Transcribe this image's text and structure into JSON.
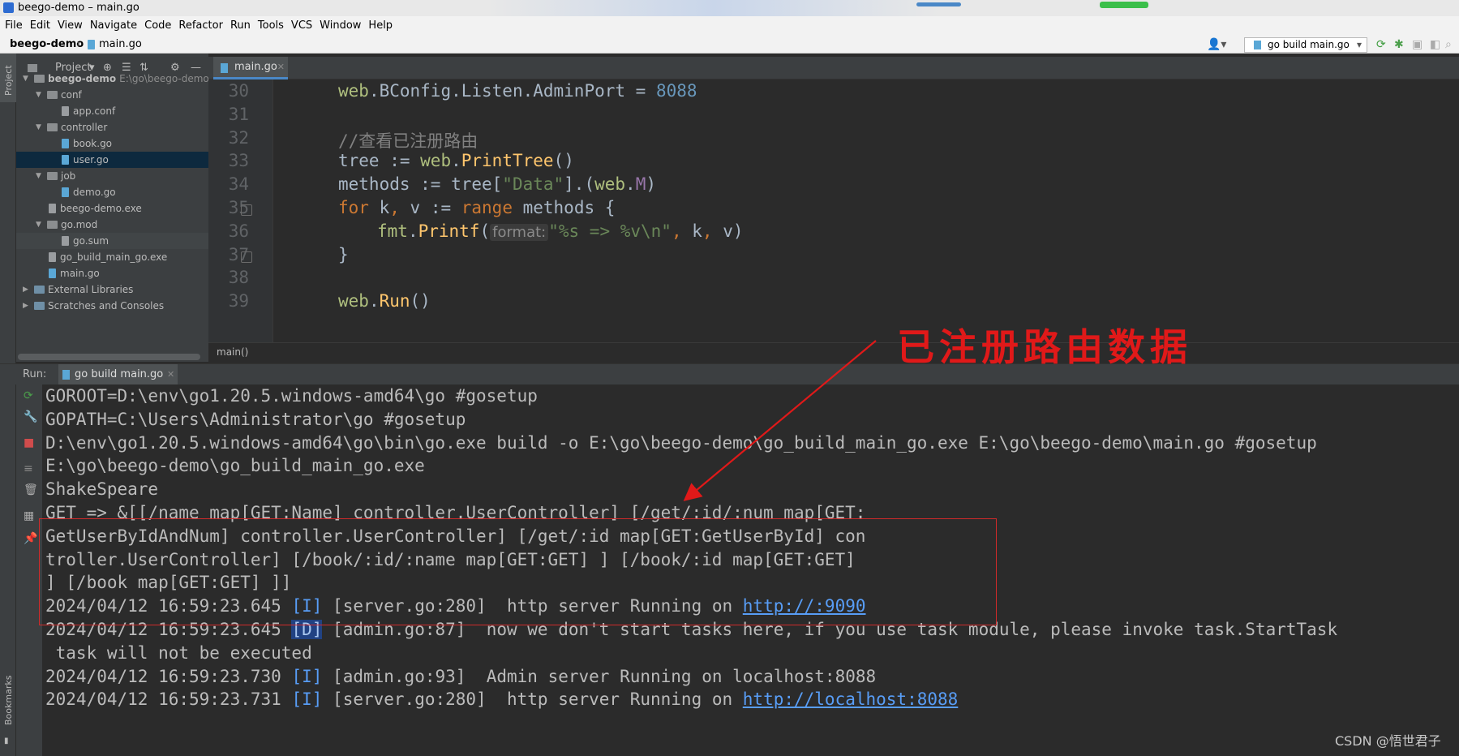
{
  "window": {
    "title": "beego-demo – main.go"
  },
  "menu": [
    "File",
    "Edit",
    "View",
    "Navigate",
    "Code",
    "Refactor",
    "Run",
    "Tools",
    "VCS",
    "Window",
    "Help"
  ],
  "nav": {
    "project": "beego-demo",
    "file": "main.go",
    "run_config": "go build main.go"
  },
  "sidebar": {
    "project_label": "Project",
    "bookmarks_label": "Bookmarks"
  },
  "project_panel": {
    "title": "Project",
    "items": [
      {
        "label": "beego-demo",
        "extra": "E:\\go\\beego-demo",
        "type": "folder",
        "depth": 0,
        "expanded": true
      },
      {
        "label": "conf",
        "type": "folder",
        "depth": 1,
        "expanded": true
      },
      {
        "label": "app.conf",
        "type": "file",
        "depth": 2
      },
      {
        "label": "controller",
        "type": "folder",
        "depth": 1,
        "expanded": true
      },
      {
        "label": "book.go",
        "type": "go",
        "depth": 2
      },
      {
        "label": "user.go",
        "type": "go",
        "depth": 2,
        "selected": true
      },
      {
        "label": "job",
        "type": "folder",
        "depth": 1,
        "expanded": true
      },
      {
        "label": "demo.go",
        "type": "go",
        "depth": 2
      },
      {
        "label": "beego-demo.exe",
        "type": "file",
        "depth": 1
      },
      {
        "label": "go.mod",
        "type": "folder",
        "depth": 1,
        "expanded": true
      },
      {
        "label": "go.sum",
        "type": "file",
        "depth": 2,
        "highlighted": true
      },
      {
        "label": "go_build_main_go.exe",
        "type": "file",
        "depth": 1
      },
      {
        "label": "main.go",
        "type": "go",
        "depth": 1
      },
      {
        "label": "External Libraries",
        "type": "lib",
        "depth": 0,
        "expanded": false
      },
      {
        "label": "Scratches and Consoles",
        "type": "lib",
        "depth": 0,
        "expanded": false
      }
    ]
  },
  "editor": {
    "tab": "main.go",
    "breadcrumb": "main()",
    "lines": [
      {
        "n": "30",
        "code": "web.BConfig.Listen.AdminPort = 8088"
      },
      {
        "n": "31",
        "code": ""
      },
      {
        "n": "32",
        "code": "//查看已注册路由"
      },
      {
        "n": "33",
        "code": "tree := web.PrintTree()"
      },
      {
        "n": "34",
        "code": "methods := tree[\"Data\"].(web.M)"
      },
      {
        "n": "35",
        "code": "for k, v := range methods {"
      },
      {
        "n": "36",
        "code": "fmt.Printf(format: \"%s => %v\\n\", k, v)"
      },
      {
        "n": "37",
        "code": "}"
      },
      {
        "n": "38",
        "code": ""
      },
      {
        "n": "39",
        "code": "web.Run()"
      }
    ],
    "hint": "format:"
  },
  "run": {
    "label": "Run:",
    "tab": "go build main.go",
    "console": [
      "GOROOT=D:\\env\\go1.20.5.windows-amd64\\go #gosetup",
      "GOPATH=C:\\Users\\Administrator\\go #gosetup",
      "D:\\env\\go1.20.5.windows-amd64\\go\\bin\\go.exe build -o E:\\go\\beego-demo\\go_build_main_go.exe E:\\go\\beego-demo\\main.go #gosetup",
      "E:\\go\\beego-demo\\go_build_main_go.exe",
      "ShakeSpeare",
      "GET => &[[/name map[GET:Name] controller.UserController] [/get/:id/:num map[GET:",
      "GetUserByIdAndNum] controller.UserController] [/get/:id map[GET:GetUserById] con",
      "troller.UserController] [/book/:id/:name map[GET:GET] ] [/book/:id map[GET:GET]",
      "] [/book map[GET:GET] ]]"
    ],
    "log": [
      {
        "ts": "2024/04/12 16:59:23.645",
        "level": "[I]",
        "src": "[server.go:280]",
        "msg": "  http server Running on ",
        "link": "http://:9090"
      },
      {
        "ts": "2024/04/12 16:59:23.645",
        "level": "[D]",
        "src": "[admin.go:87]",
        "msg": "  now we don't start tasks here, if you use task module, please invoke task.StartTask",
        "link": ""
      },
      {
        "ts": "",
        "level": "",
        "src": "",
        "msg": " task will not be executed",
        "link": ""
      },
      {
        "ts": "2024/04/12 16:59:23.730",
        "level": "[I]",
        "src": "[admin.go:93]",
        "msg": "  Admin server Running on localhost:8088",
        "link": ""
      },
      {
        "ts": "2024/04/12 16:59:23.731",
        "level": "[I]",
        "src": "[server.go:280]",
        "msg": "  http server Running on ",
        "link": "http://localhost:8088"
      }
    ]
  },
  "annotation": {
    "text": "已注册路由数据",
    "color": "#e01919"
  },
  "watermark": "CSDN @悟世君子",
  "colors": {
    "accent": "#4a88c7",
    "keyword": "#cc7832",
    "function": "#ffc66d",
    "string": "#6a8759",
    "number": "#6897bb",
    "link": "#589df6"
  }
}
